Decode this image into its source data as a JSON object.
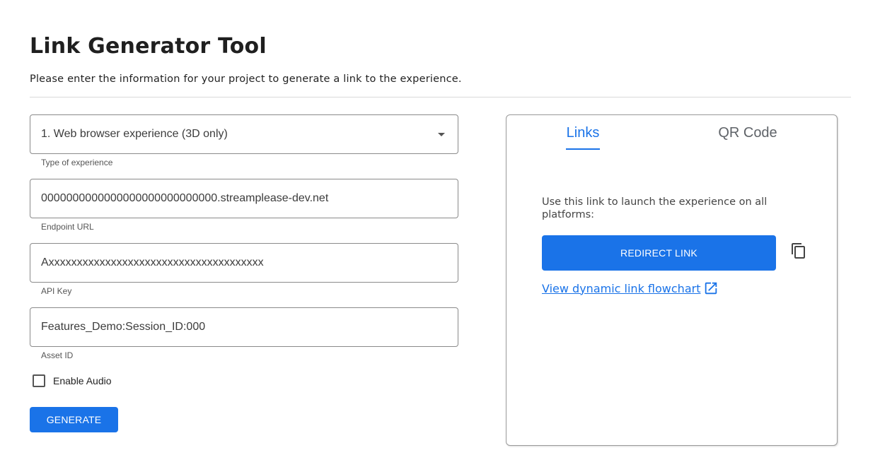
{
  "header": {
    "title": "Link Generator Tool",
    "subtitle": "Please enter the information for your project to generate a link to the experience."
  },
  "form": {
    "experience_type": {
      "value": "1. Web browser experience (3D only)",
      "helper": "Type of experience"
    },
    "endpoint": {
      "value": "0000000000000000000000000000.streamplease-dev.net",
      "helper": "Endpoint URL"
    },
    "api_key": {
      "value": "Axxxxxxxxxxxxxxxxxxxxxxxxxxxxxxxxxxxxxx",
      "helper": "API Key"
    },
    "asset_id": {
      "value": "Features_Demo:Session_ID:000",
      "helper": "Asset ID"
    },
    "enable_audio": {
      "label": "Enable Audio",
      "checked": false
    },
    "generate_label": "GENERATE"
  },
  "panel": {
    "tabs": [
      {
        "label": "Links",
        "active": true
      },
      {
        "label": "QR Code",
        "active": false
      }
    ],
    "description": "Use this link to launch the experience on all platforms:",
    "redirect_label": "REDIRECT LINK",
    "flowchart_link": "View dynamic link flowchart"
  },
  "colors": {
    "accent": "#1a73e8",
    "border": "#8a8a8a"
  },
  "icons": [
    "dropdown-arrow-icon",
    "copy-icon",
    "external-link-icon"
  ]
}
